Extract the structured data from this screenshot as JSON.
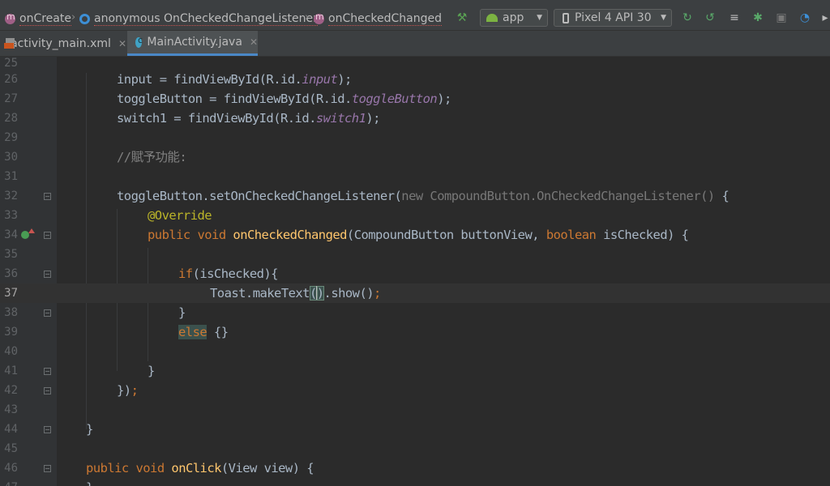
{
  "breadcrumbs": [
    "onCreate",
    "anonymous OnCheckedChangeListener",
    "onCheckedChanged"
  ],
  "toolbar": {
    "run_config": "app",
    "device": "Pixel 4 API 30"
  },
  "tabs": [
    {
      "label": "activity_main.xml",
      "active": false
    },
    {
      "label": "MainActivity.java",
      "active": true
    }
  ],
  "editor": {
    "lines": [
      {
        "n": "25"
      },
      {
        "n": "26"
      },
      {
        "n": "27"
      },
      {
        "n": "28"
      },
      {
        "n": "29"
      },
      {
        "n": "30"
      },
      {
        "n": "31"
      },
      {
        "n": "32"
      },
      {
        "n": "33"
      },
      {
        "n": "34"
      },
      {
        "n": "35"
      },
      {
        "n": "36"
      },
      {
        "n": "37"
      },
      {
        "n": "38"
      },
      {
        "n": "39"
      },
      {
        "n": "40"
      },
      {
        "n": "41"
      },
      {
        "n": "42"
      },
      {
        "n": "43"
      },
      {
        "n": "44"
      },
      {
        "n": "45"
      },
      {
        "n": "46"
      },
      {
        "n": "47"
      }
    ],
    "code": {
      "l26": {
        "a": "input = findViewById(R.id.",
        "b": "input",
        "c": ");"
      },
      "l27": {
        "a": "toggleButton = findViewById(R.id.",
        "b": "toggleButton",
        "c": ");"
      },
      "l28": {
        "a": "switch1 = findViewById(R.id.",
        "b": "switch1",
        "c": ");"
      },
      "l30": "//賦予功能:",
      "l32": {
        "a": "toggleButton.setOnCheckedChangeListener(",
        "b": "new CompoundButton.OnCheckedChangeListener() ",
        "c": "{"
      },
      "l33": "@Override",
      "l34": {
        "kw1": "public ",
        "kw2": "void ",
        "fn": "onCheckedChanged",
        "a": "(CompoundButton buttonView, ",
        "kw3": "boolean ",
        "b": "isChecked) {"
      },
      "l36": {
        "kw": "if",
        "a": "(isChecked){"
      },
      "l37": {
        "a": "Toast.makeText",
        "p1": "(",
        "p2": ")",
        "b": ".show()",
        "c": ";"
      },
      "l38": "}",
      "l39": {
        "kw": "else",
        "a": " {}"
      },
      "l41": "}",
      "l42": {
        "a": "})",
        "b": ";"
      },
      "l44": "}",
      "l46": {
        "kw1": "public ",
        "kw2": "void ",
        "fn": "onClick",
        "a": "(View view) {"
      },
      "l47": "}"
    }
  }
}
